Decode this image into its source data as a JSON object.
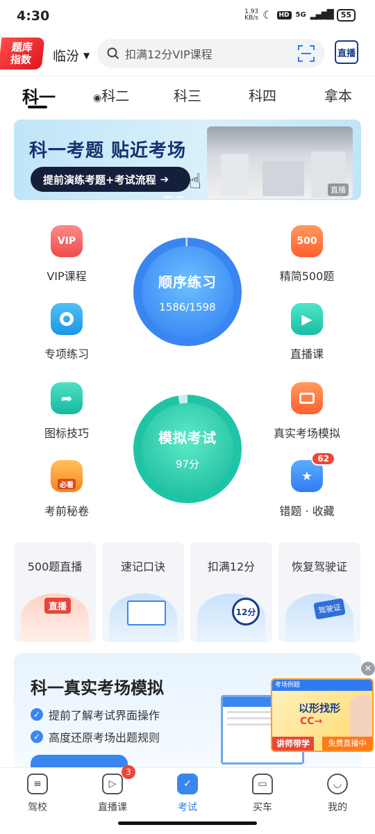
{
  "status": {
    "time": "4:30",
    "speed": "1.93\nKB/s",
    "net": "5G",
    "hd": "HD",
    "battery": "55"
  },
  "header": {
    "logo": "题库\n指数",
    "city": "临汾",
    "search_placeholder": "扣满12分VIP课程",
    "live_label": "直播"
  },
  "tabs": [
    "科一",
    "科二",
    "科三",
    "科四",
    "拿本"
  ],
  "banner": {
    "title": "科一考题 贴近考场",
    "button": "提前演练考题+考试流程",
    "tag": "直播"
  },
  "grid": {
    "left": [
      {
        "label": "VIP课程",
        "icon": "vip-icon",
        "color": "#f05a5a"
      },
      {
        "label": "专项练习",
        "icon": "target-icon",
        "color": "#1fa3e8"
      },
      {
        "label": "图标技巧",
        "icon": "arrow-sign-icon",
        "color": "#20c4a8"
      },
      {
        "label": "考前秘卷",
        "icon": "exam-paper-icon",
        "color": "#f58a1f"
      }
    ],
    "right": [
      {
        "label": "精简500题",
        "icon": "500-icon",
        "color": "#ff6b35"
      },
      {
        "label": "直播课",
        "icon": "play-icon",
        "color": "#23c8b0"
      },
      {
        "label": "真实考场模拟",
        "icon": "monitor-icon",
        "color": "#ff6b35"
      },
      {
        "label": "错题 · 收藏",
        "icon": "star-box-icon",
        "color": "#2f8af0",
        "badge": "62"
      }
    ],
    "order": {
      "title": "顺序练习",
      "value": "1586/1598"
    },
    "mock": {
      "title": "模拟考试",
      "value": "97分"
    },
    "vip_text": "VIP",
    "five_text": "500",
    "must_text": "必看"
  },
  "quick": [
    "500题直播",
    "速记口诀",
    "扣满12分",
    "恢复驾驶证"
  ],
  "quick_art": {
    "live": "直播",
    "points": "12分",
    "license": "驾驶证"
  },
  "promo": {
    "title": "科一真实考场模拟",
    "items": [
      "提前了解考试界面操作",
      "高度还原考场出题规则"
    ],
    "ad_main": "以形找形",
    "ad_sub": "CC→",
    "ad_teacher": "讲师带学",
    "ad_live": "免费直播中",
    "ad_q": "考场例题"
  },
  "nav": [
    {
      "label": "驾校",
      "icon": "school-icon"
    },
    {
      "label": "直播课",
      "icon": "tv-icon",
      "badge": "3"
    },
    {
      "label": "考试",
      "icon": "exam-icon"
    },
    {
      "label": "买车",
      "icon": "car-icon"
    },
    {
      "label": "我的",
      "icon": "smile-icon"
    }
  ]
}
